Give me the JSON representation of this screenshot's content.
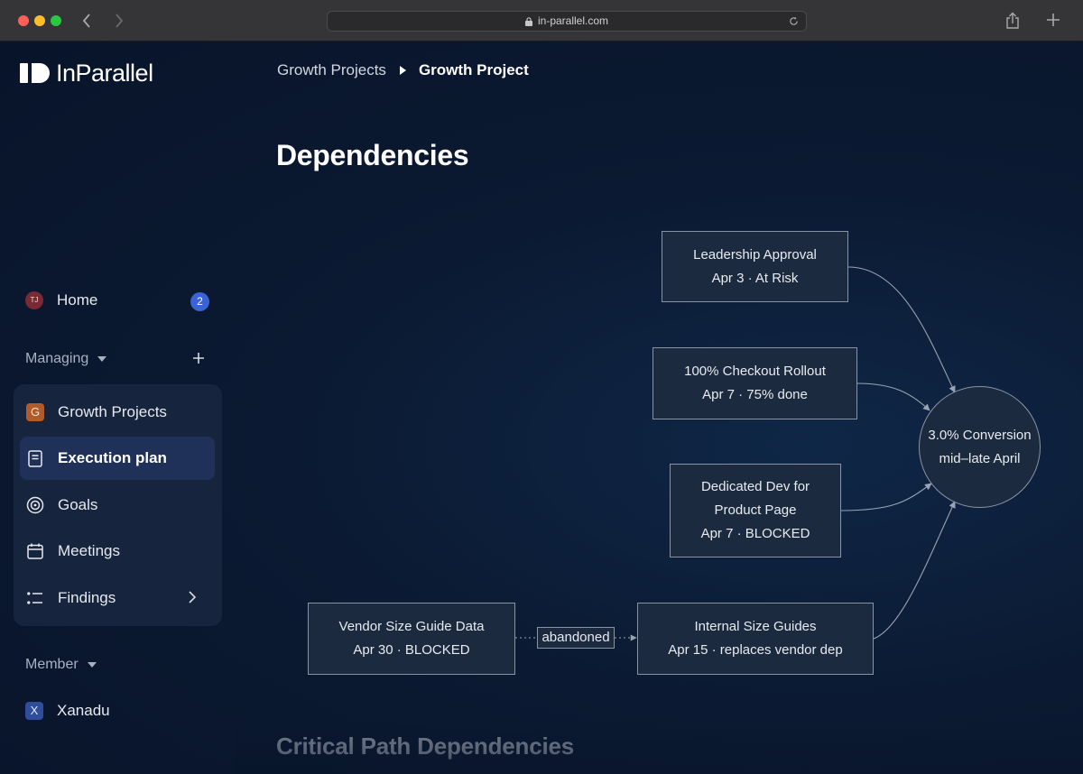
{
  "browser": {
    "url": "in-parallel.com"
  },
  "brand": {
    "name": "InParallel"
  },
  "sidebar": {
    "home": {
      "avatar": "TJ",
      "label": "Home",
      "badge": "2"
    },
    "managing": {
      "label": "Managing"
    },
    "items": [
      {
        "label": "Growth Projects",
        "icon": "G"
      },
      {
        "label": "Execution plan",
        "icon": "document-icon"
      },
      {
        "label": "Goals",
        "icon": "target-icon"
      },
      {
        "label": "Meetings",
        "icon": "calendar-icon"
      },
      {
        "label": "Findings",
        "icon": "list-icon"
      }
    ],
    "member": {
      "label": "Member",
      "workspace": "Xanadu",
      "workspace_icon": "X"
    }
  },
  "breadcrumb": {
    "parent": "Growth Projects",
    "current": "Growth Project"
  },
  "page": {
    "title": "Dependencies",
    "next_section": "Critical Path Dependencies"
  },
  "diagram": {
    "nodes": {
      "leadership": {
        "line1": "Leadership Approval",
        "line2": "Apr 3 · At Risk"
      },
      "checkout": {
        "line1": "100% Checkout Rollout",
        "line2": "Apr 7 · 75% done"
      },
      "dev": {
        "line1": "Dedicated Dev for",
        "line2": "Product Page",
        "line3": "Apr 7 · BLOCKED"
      },
      "vendor": {
        "line1": "Vendor Size Guide Data",
        "line2": "Apr 30 · BLOCKED"
      },
      "internal": {
        "line1": "Internal Size Guides",
        "line2": "Apr 15 · replaces vendor dep"
      },
      "goal": {
        "line1": "3.0% Conversion",
        "line2": "mid–late April"
      }
    },
    "edge_label": "abandoned"
  },
  "colors": {
    "background": "#0b1a32",
    "node_fill": "#1b2a3e",
    "node_border": "#8a93a3",
    "active_item": "#1f3158",
    "badge": "#3a63d6"
  }
}
